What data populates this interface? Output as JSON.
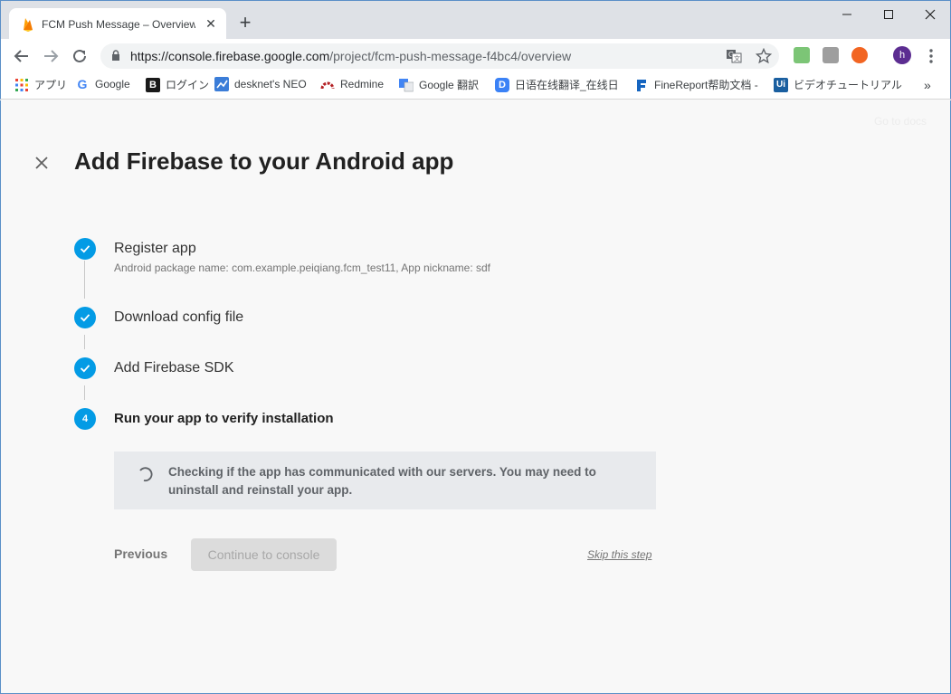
{
  "browser": {
    "tab": {
      "title": "FCM Push Message – Overview –",
      "close": "✕"
    },
    "new_tab": "+",
    "url": {
      "host": "https://console.firebase.google.com",
      "path": "/project/fcm-push-message-f4bc4/overview"
    },
    "profile_initial": "h",
    "bookmarks": [
      {
        "label": "アプリ",
        "icon": "apps-grid-icon"
      },
      {
        "label": "Google",
        "icon": "google-icon",
        "color": "#4285f4",
        "glyph": "G"
      },
      {
        "label": "ログイン",
        "icon": "b-icon",
        "color": "#1a1a1a",
        "glyph": "B"
      },
      {
        "label": "desknet's NEO",
        "icon": "desknets-icon",
        "color": "#3b7dd8",
        "glyph": ""
      },
      {
        "label": "Redmine",
        "icon": "redmine-icon",
        "color": "#b32024",
        "glyph": ""
      },
      {
        "label": "Google 翻訳",
        "icon": "translate-icon",
        "color": "#4285f4",
        "glyph": ""
      },
      {
        "label": "日语在线翻译_在线日",
        "icon": "d-icon",
        "color": "#3b82f6",
        "glyph": "D"
      },
      {
        "label": "FineReport帮助文档 -",
        "icon": "finereport-icon",
        "color": "#1565c0",
        "glyph": ""
      },
      {
        "label": "ビデオチュートリアル",
        "icon": "ui-icon",
        "color": "#1a5fa0",
        "glyph": "Ui"
      }
    ],
    "bookmarks_more": "»"
  },
  "page": {
    "go_to_docs": "Go to docs",
    "title": "Add Firebase to your Android app",
    "steps": [
      {
        "title": "Register app",
        "subtitle": "Android package name: com.example.peiqiang.fcm_test11, App nickname: sdf",
        "status": "done"
      },
      {
        "title": "Download config file",
        "status": "done"
      },
      {
        "title": "Add Firebase SDK",
        "status": "done"
      },
      {
        "title": "Run your app to verify installation",
        "number": "4",
        "status": "active"
      }
    ],
    "checking_message": "Checking if the app has communicated with our servers. You may need to uninstall and reinstall your app.",
    "previous_label": "Previous",
    "continue_label": "Continue to console",
    "skip_label": "Skip this step"
  },
  "colors": {
    "accent": "#039be5",
    "page_bg": "#f8f8f8",
    "info_box_bg": "#e8eaed"
  }
}
